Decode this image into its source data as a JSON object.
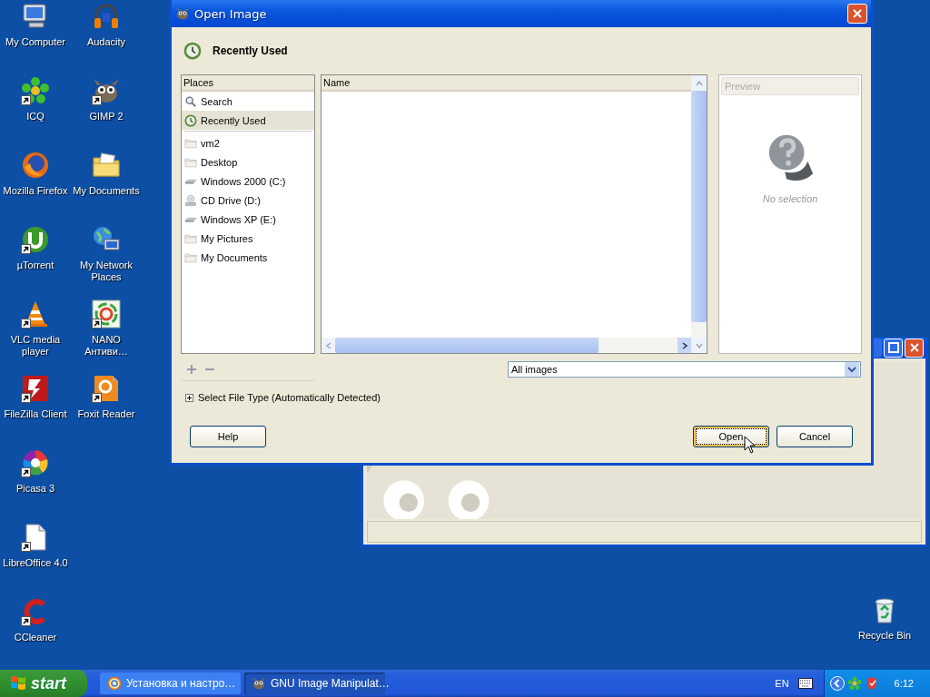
{
  "desktop": {
    "icon_columns": [
      [
        {
          "label": "My Computer",
          "kind": "computer",
          "shortcut": false
        },
        {
          "label": "ICQ",
          "kind": "flower",
          "shortcut": true
        },
        {
          "label": "Mozilla Firefox",
          "kind": "fox",
          "shortcut": false
        },
        {
          "label": "µTorrent",
          "kind": "torrent",
          "shortcut": true
        },
        {
          "label": "VLC media player",
          "kind": "cone",
          "shortcut": true
        },
        {
          "label": "FileZilla Client",
          "kind": "zilla",
          "shortcut": true
        },
        {
          "label": "Picasa 3",
          "kind": "pinwheel",
          "shortcut": true
        },
        {
          "label": "LibreOffice 4.0",
          "kind": "page",
          "shortcut": true
        },
        {
          "label": "CCleaner",
          "kind": "cleaner",
          "shortcut": true
        }
      ],
      [
        {
          "label": "Audacity",
          "kind": "headphones",
          "shortcut": false
        },
        {
          "label": "GIMP 2",
          "kind": "mascot",
          "shortcut": true
        },
        {
          "label": "My Documents",
          "kind": "docfolder",
          "shortcut": false
        },
        {
          "label": "My Network Places",
          "kind": "network",
          "shortcut": false
        },
        {
          "label": "NANO Антиви…",
          "kind": "rings",
          "shortcut": true
        },
        {
          "label": "Foxit Reader",
          "kind": "pdf",
          "shortcut": true
        }
      ]
    ],
    "recycle_bin": {
      "label": "Recycle Bin",
      "kind": "bin",
      "shortcut": false
    }
  },
  "dialog": {
    "title": "Open Image",
    "location": "Recently Used",
    "places": {
      "header": "Places",
      "top": [
        {
          "label": "Search",
          "kind": "search",
          "selected": false
        },
        {
          "label": "Recently Used",
          "kind": "recent",
          "selected": true
        }
      ],
      "bookmarks": [
        {
          "label": "vm2",
          "kind": "folder",
          "selected": false
        },
        {
          "label": "Desktop",
          "kind": "folder",
          "selected": false
        },
        {
          "label": "Windows 2000 (C:)",
          "kind": "drive",
          "selected": false
        },
        {
          "label": "CD Drive (D:)",
          "kind": "cd",
          "selected": false
        },
        {
          "label": "Windows XP (E:)",
          "kind": "drive",
          "selected": false
        },
        {
          "label": "My Pictures",
          "kind": "folder",
          "selected": false
        },
        {
          "label": "My Documents",
          "kind": "folder",
          "selected": false
        }
      ]
    },
    "files": {
      "column": "Name"
    },
    "preview": {
      "header": "Preview",
      "message": "No selection"
    },
    "filter": "All images",
    "expander": {
      "label": "Select File Type (Automatically Detected)",
      "expanded": false
    },
    "buttons": [
      {
        "label": "Help",
        "default": false
      },
      {
        "label": "Open",
        "default": true
      },
      {
        "label": "Cancel",
        "default": false
      }
    ]
  },
  "taskbar": {
    "start": "start",
    "tasks": [
      {
        "label": "Установка и настро…",
        "kind": "browser",
        "selected": false
      },
      {
        "label": "GNU Image Manipulat…",
        "kind": "mascot",
        "selected": true
      }
    ],
    "language": "EN",
    "clock": "6:12"
  }
}
